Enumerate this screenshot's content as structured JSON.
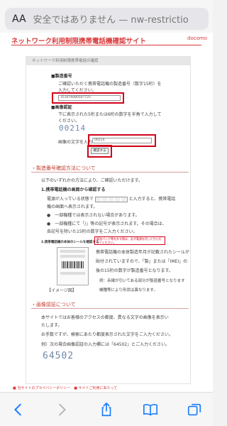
{
  "browser": {
    "aa_label": "AA",
    "url_text": "安全ではありません — nw-restrictio"
  },
  "site": {
    "title": "ネットワーク利用制限携帯電話機確認サイト",
    "right_text": "docomo"
  },
  "panel": {
    "header": "ネットワーク利用制限携帯電話の確認",
    "serial_heading": "■製造番号",
    "serial_desc_1": "ご確認いただく携帯電話機の製造番号（数字15桁）を",
    "serial_desc_2": "入力してください。",
    "serial_value": "353076080507725",
    "captcha_heading": "■画像認証",
    "captcha_desc": "下に表示された5桁または6桁の数字を半角で入力して",
    "captcha_desc_2": "ください。",
    "captcha_image_text": "00214",
    "captcha_input_label": "画像の文字を入力",
    "captcha_value": "00214",
    "submit_label": "確認する"
  },
  "section_serial": {
    "heading": "・製造番号確認方法について",
    "intro": "以下のいずれかの方法により、ご確認いただけます。",
    "method1_title": "1.携帯電話機の画面から確認する",
    "method1_line1": "電源が入っている状態で",
    "method1_line1b": "と入力すると、携帯電話",
    "method1_line2": "機の画面へ表示されます。",
    "bullet1": "●　一部機種では表示されない場合があります。",
    "bullet2": "●　一部機種にて「/」等の記号が表示されます。その場合は、",
    "bullet2b": "各記号を除いた15桁の数字をご入力ください。",
    "method2_title": "2.携帯電話機の本体のシールを確認する",
    "warn": "電池パック等を外す際は、必ず電源を切ってから行ってください。",
    "method2_line1": "携帯電話機の本体製造年月が記載されたシールが",
    "method2_line2": "貼付されていますので、「製」または「IMEI」の",
    "method2_line3": "後の15桁の数字が製造番号となります。",
    "method2_note1": "例：赤線が引いてある部分が製造番号となります",
    "image_label": "【イメージ図】",
    "method2_note2": "機種等により形状は異なります。"
  },
  "section_captcha": {
    "heading": "・画像認証について",
    "line1": "本サイトではお客様のアクセスの都度、異なる文字の画像を表示い",
    "line2": "たします。",
    "line3": "お手数ですが、検索にあたり都度表示された文字をご入力ください。",
    "example": "例）次の場合画像認証の入力欄には「64502」とご入力ください。",
    "example_image": "64502"
  },
  "footer": {
    "text": "■ 当サイトのプライバシーポリシー　■ サイトご利用にあたって"
  },
  "colors": {
    "brand_red": "#d8393b",
    "highlight_red": "#d0021b",
    "safari_blue": "#1a7cff"
  }
}
